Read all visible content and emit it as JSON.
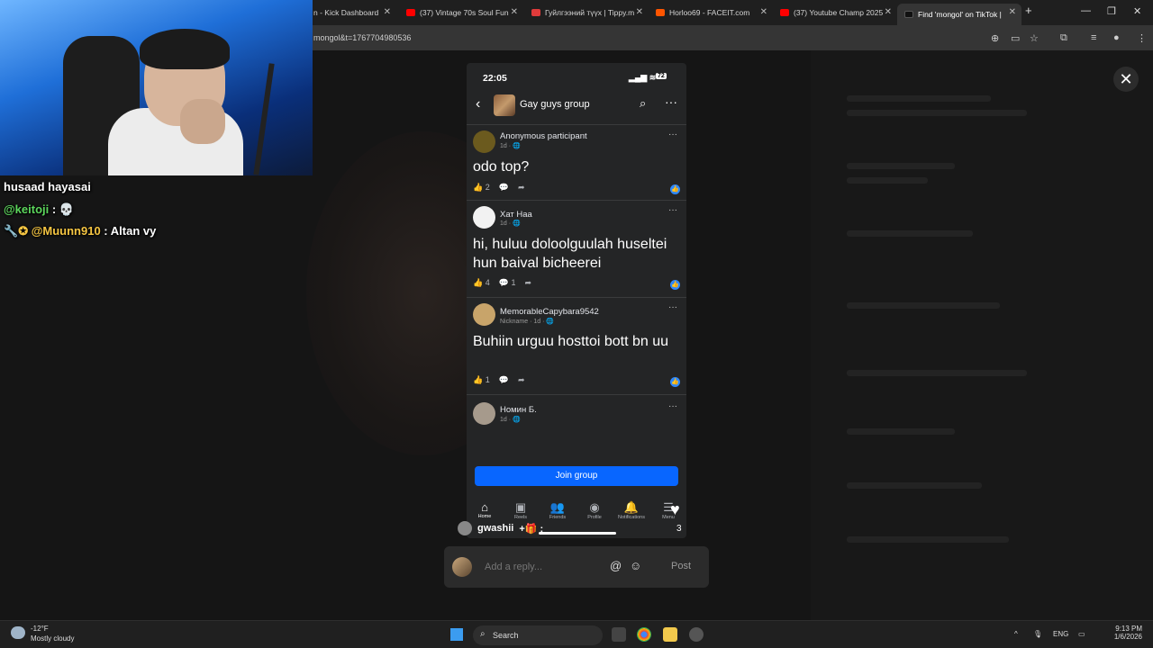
{
  "browser": {
    "tabs": [
      {
        "label": "n - Kick Dashboard",
        "icon_color": "#53fc18"
      },
      {
        "label": "(37) Vintage 70s Soul Fun",
        "icon_color": "#ff0000"
      },
      {
        "label": "Гуйлгээний түүх | Tippy.m",
        "icon_color": "#e03b3b"
      },
      {
        "label": "Horloo69 - FACEIT.com",
        "icon_color": "#ff5500"
      },
      {
        "label": "(37) Youtube Champ 2025",
        "icon_color": "#ff0000"
      },
      {
        "label": "Find 'mongol' on TikTok |",
        "icon_color": "#111111"
      }
    ],
    "new_tab": "+",
    "url": "mongol&t=1767704980536"
  },
  "overlay_close": "✕",
  "chat": [
    {
      "user": "husaad hayasai",
      "message": ""
    },
    {
      "user": "@keitoji",
      "message": "💀"
    },
    {
      "user": "@Muunn910",
      "message": "Altan vy"
    }
  ],
  "phone": {
    "status_time": "22:05",
    "battery": "72",
    "group_name": "Gay guys group",
    "posts": [
      {
        "author": "Anonymous participant",
        "meta": "1d · 🌐",
        "body": "odo top?",
        "likes": "2",
        "comments": ""
      },
      {
        "author": "Хат Наа",
        "meta": "1d · 🌐",
        "body": "hi, huluu doloolguulah huseltei hun baival bicheerei",
        "likes": "4",
        "comments": "1"
      },
      {
        "author": "MemorableCapybara9542",
        "meta": "Nickname · 1d · 🌐",
        "body": "Buhiin urguu hosttoi bott bn uu",
        "likes": "1",
        "comments": ""
      },
      {
        "author": "Номин Б.",
        "meta": "1d · 🌐",
        "body": "",
        "likes": "",
        "comments": ""
      }
    ],
    "join_label": "Join group",
    "nav": [
      {
        "label": "Home",
        "icon": "⌂"
      },
      {
        "label": "Reels",
        "icon": "▣"
      },
      {
        "label": "Friends",
        "icon": "👥"
      },
      {
        "label": "Profile",
        "icon": "◉"
      },
      {
        "label": "Notifications",
        "icon": "🔔"
      },
      {
        "label": "Menu",
        "icon": "☰"
      }
    ]
  },
  "comment_bar": {
    "user": "gwashii",
    "extra": "+🎁 :"
  },
  "likes_count": "3",
  "reply": {
    "placeholder": "Add a reply...",
    "post_label": "Post"
  },
  "taskbar": {
    "temperature": "-12°F",
    "condition": "Mostly cloudy",
    "search_label": "Search",
    "language": "ENG",
    "time": "9:13 PM",
    "date": "1/6/2026"
  }
}
